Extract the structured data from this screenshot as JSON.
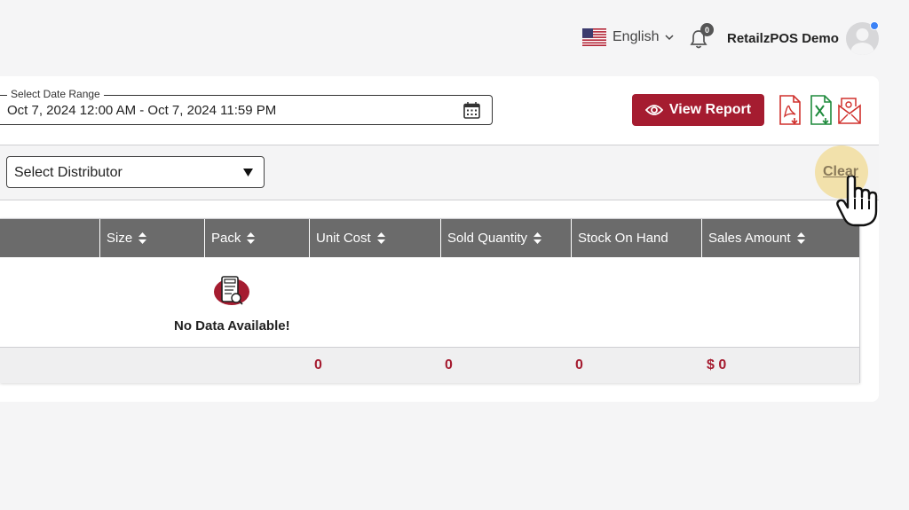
{
  "header": {
    "language": "English",
    "notification_count": "0",
    "user_name": "RetailzPOS Demo"
  },
  "report": {
    "date_range_label": "Select Date Range",
    "date_range_value": "Oct 7, 2024 12:00 AM - Oct 7, 2024 11:59 PM",
    "view_report_label": "View Report",
    "distributor_placeholder": "Select Distributor",
    "clear_label": "Clear"
  },
  "table": {
    "columns": [
      "Size",
      "Pack",
      "Unit Cost",
      "Sold Quantity",
      "Stock On Hand",
      "Sales Amount"
    ],
    "empty_message": "No Data Available!",
    "totals": {
      "unit_cost": "0",
      "sold_quantity": "0",
      "stock_on_hand": "0",
      "sales_amount": "$ 0"
    }
  },
  "colors": {
    "accent": "#a51c30",
    "header_bg": "#6b6b6b",
    "page_bg": "#f5f5f6"
  },
  "icons": [
    "us-flag-icon",
    "chevron-down-icon",
    "bell-icon",
    "avatar-icon",
    "calendar-icon",
    "eye-icon",
    "pdf-export-icon",
    "excel-export-icon",
    "email-export-icon",
    "dropdown-arrow-icon",
    "sort-icon",
    "no-data-icon",
    "hand-cursor-icon"
  ]
}
